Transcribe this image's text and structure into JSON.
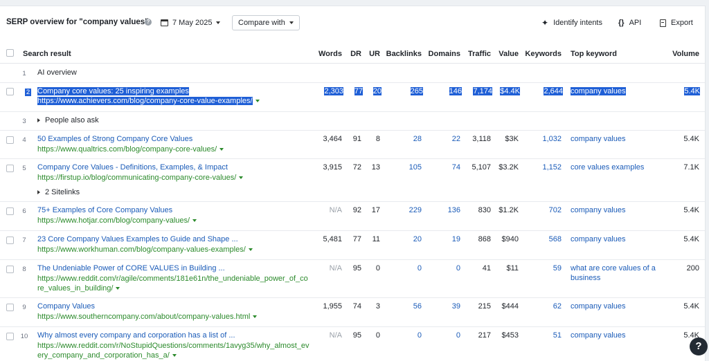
{
  "header": {
    "title": "SERP overview for \"company values\"",
    "date": "7 May 2025",
    "compare_label": "Compare with",
    "identify_intents": "Identify intents",
    "api": "API",
    "export": "Export"
  },
  "columns": {
    "search_result": "Search result",
    "words": "Words",
    "dr": "DR",
    "ur": "UR",
    "backlinks": "Backlinks",
    "domains": "Domains",
    "traffic": "Traffic",
    "value": "Value",
    "keywords": "Keywords",
    "top_keyword": "Top keyword",
    "volume": "Volume"
  },
  "rows": [
    {
      "pos": "1",
      "type": "feature",
      "label": "AI overview"
    },
    {
      "pos": "2",
      "title": "Company core values: 25 inspiring examples",
      "url": "https://www.achievers.com/blog/company-core-value-examples/",
      "words": "2,303",
      "dr": "77",
      "ur": "20",
      "backlinks": "265",
      "domains": "146",
      "traffic": "7,174",
      "value": "$4.4K",
      "keywords": "2,644",
      "top_keyword": "company values",
      "volume": "5.4K"
    },
    {
      "pos": "3",
      "type": "feature",
      "label": "People also ask"
    },
    {
      "pos": "4",
      "title": "50 Examples of Strong Company Core Values",
      "url": "https://www.qualtrics.com/blog/company-core-values/",
      "words": "3,464",
      "dr": "91",
      "ur": "8",
      "backlinks": "28",
      "domains": "22",
      "traffic": "3,118",
      "value": "$3K",
      "keywords": "1,032",
      "top_keyword": "company values",
      "volume": "5.4K"
    },
    {
      "pos": "5",
      "title": "Company Core Values - Definitions, Examples, & Impact",
      "url": "https://firstup.io/blog/communicating-company-core-values/",
      "sitelinks": "2 Sitelinks",
      "words": "3,915",
      "dr": "72",
      "ur": "13",
      "backlinks": "105",
      "domains": "74",
      "traffic": "5,107",
      "value": "$3.2K",
      "keywords": "1,152",
      "top_keyword": "core values examples",
      "volume": "7.1K"
    },
    {
      "pos": "6",
      "title": "75+ Examples of Core Company Values",
      "url": "https://www.hotjar.com/blog/company-values/",
      "words": "N/A",
      "dr": "92",
      "ur": "17",
      "backlinks": "229",
      "domains": "136",
      "traffic": "830",
      "value": "$1.2K",
      "keywords": "702",
      "top_keyword": "company values",
      "volume": "5.4K"
    },
    {
      "pos": "7",
      "title": "23 Core Company Values Examples to Guide and Shape ...",
      "url": "https://www.workhuman.com/blog/company-values-examples/",
      "words": "5,481",
      "dr": "77",
      "ur": "11",
      "backlinks": "20",
      "domains": "19",
      "traffic": "868",
      "value": "$940",
      "keywords": "568",
      "top_keyword": "company values",
      "volume": "5.4K"
    },
    {
      "pos": "8",
      "title": "The Undeniable Power of CORE VALUES in Building ...",
      "url_line1": "https://www.reddit.com/r/agile/comments/181e61n/the_undeniable_power_of_co",
      "url_line2": "re_values_in_building/",
      "words": "N/A",
      "dr": "95",
      "ur": "0",
      "backlinks": "0",
      "domains": "0",
      "traffic": "41",
      "value": "$11",
      "keywords": "59",
      "top_keyword_line1": "what are core values of a",
      "top_keyword_line2": "business",
      "volume": "200"
    },
    {
      "pos": "9",
      "title": "Company Values",
      "url": "https://www.southerncompany.com/about/company-values.html",
      "words": "1,955",
      "dr": "74",
      "ur": "3",
      "backlinks": "56",
      "domains": "39",
      "traffic": "215",
      "value": "$444",
      "keywords": "62",
      "top_keyword": "company values",
      "volume": "5.4K"
    },
    {
      "pos": "10",
      "title": "Why almost every company and corporation has a list of ...",
      "url_line1": "https://www.reddit.com/r/NoStupidQuestions/comments/1avyg35/why_almost_ev",
      "url_line2": "ery_company_and_corporation_has_a/",
      "words": "N/A",
      "dr": "95",
      "ur": "0",
      "backlinks": "0",
      "domains": "0",
      "traffic": "217",
      "value": "$453",
      "keywords": "51",
      "top_keyword": "company values",
      "volume": "5.4K"
    }
  ],
  "help_fab": "?",
  "colors": {
    "link": "#1a5bb8",
    "url": "#2b8a2b",
    "selection": "#1f5fd6"
  }
}
